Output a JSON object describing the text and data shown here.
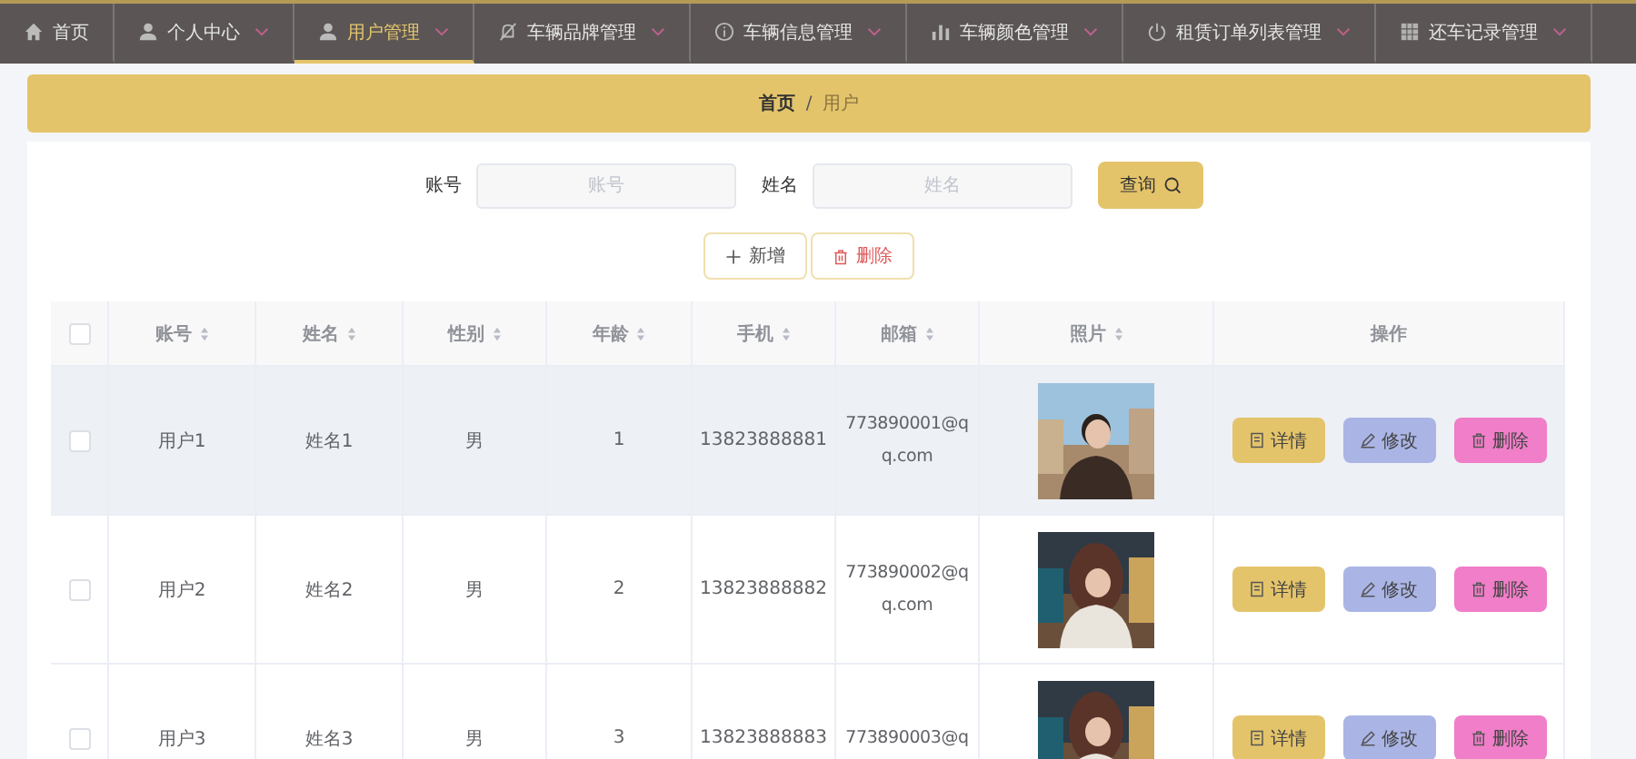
{
  "nav": [
    {
      "label": "首页",
      "selected": false
    },
    {
      "label": "个人中心",
      "selected": false
    },
    {
      "label": "用户管理",
      "selected": true
    },
    {
      "label": "车辆品牌管理",
      "selected": false
    },
    {
      "label": "车辆信息管理",
      "selected": false
    },
    {
      "label": "车辆颜色管理",
      "selected": false
    },
    {
      "label": "租赁订单列表管理",
      "selected": false
    },
    {
      "label": "还车记录管理",
      "selected": false
    }
  ],
  "breadcrumb": {
    "home": "首页",
    "separator": "/",
    "current": "用户"
  },
  "search": {
    "fields": [
      {
        "label": "账号",
        "placeholder": "账号"
      },
      {
        "label": "姓名",
        "placeholder": "姓名"
      }
    ],
    "button": "查询"
  },
  "actions": {
    "add": "新增",
    "delete": "删除"
  },
  "table": {
    "header_checked": false,
    "columns": [
      "账号",
      "姓名",
      "性别",
      "年龄",
      "手机",
      "邮箱",
      "照片",
      "操作"
    ],
    "rows": [
      {
        "checked": false,
        "hovered": true,
        "cells": [
          "用户1",
          "姓名1",
          "男",
          "1",
          "13823888881",
          "773890001@qq.com"
        ],
        "buttons": [
          "详情",
          "修改",
          "删除"
        ]
      },
      {
        "checked": false,
        "hovered": false,
        "cells": [
          "用户2",
          "姓名2",
          "男",
          "2",
          "13823888882",
          "773890002@qq.com"
        ],
        "buttons": [
          "详情",
          "修改",
          "删除"
        ]
      },
      {
        "checked": false,
        "hovered": false,
        "cells": [
          "用户3",
          "姓名3",
          "男",
          "3",
          "13823888883",
          "773890003@q"
        ],
        "buttons": [
          "详情",
          "修改",
          "删除"
        ]
      }
    ]
  }
}
